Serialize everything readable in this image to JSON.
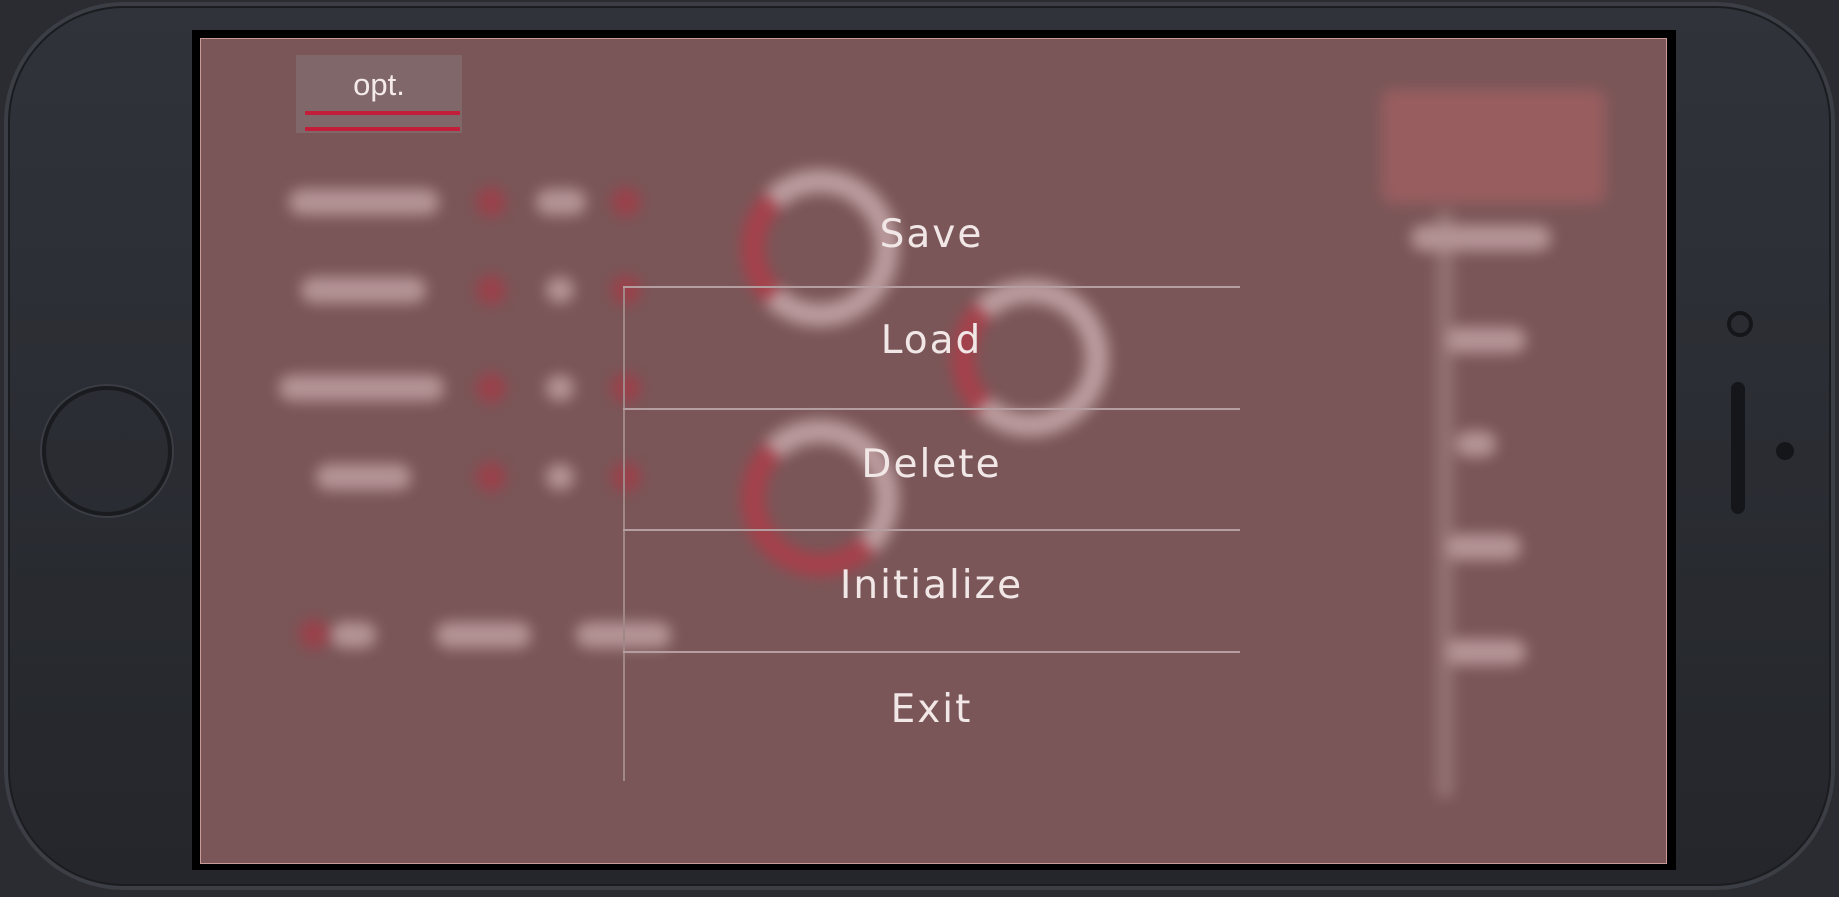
{
  "options_tab": {
    "label": "opt."
  },
  "menu": {
    "items": [
      {
        "label": "Save"
      },
      {
        "label": "Load"
      },
      {
        "label": "Delete"
      },
      {
        "label": "Initialize"
      },
      {
        "label": "Exit"
      }
    ]
  },
  "colors": {
    "overlay_background": "#7a5658",
    "accent_red": "#c21e3a",
    "menu_text": "#f1e7e7",
    "device_frame": "#2a2c32"
  }
}
